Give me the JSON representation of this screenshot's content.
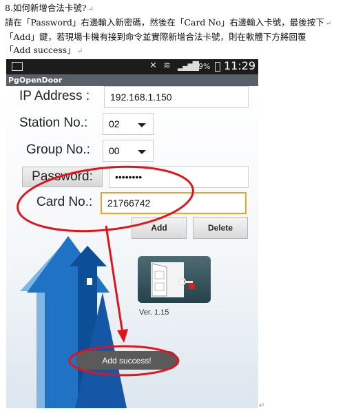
{
  "document": {
    "heading": "8.如何新增合法卡號?",
    "line1": "請在「Password」右邊輸入新密碼，然後在「Card No」右邊輸入卡號，最後按下",
    "line2": "「Add」鍵，若現場卡機有接到命令並實際新增合法卡號，則在軟體下方將回覆",
    "line3": "「Add success」",
    "return_mark": "↵"
  },
  "statusbar": {
    "battery": "69%",
    "time": "11:29",
    "icons": [
      "screenshot-icon",
      "mute-icon",
      "wifi-icon",
      "signal-icon",
      "battery-icon"
    ]
  },
  "app": {
    "title": "PgOpenDoor",
    "ip_label": "IP Address :",
    "ip_value": "192.168.1.150",
    "station_label": "Station No.:",
    "station_value": "02",
    "group_label": "Group No.:",
    "group_value": "00",
    "password_label": "Password:",
    "password_value": "••••••••",
    "card_label": "Card No.:",
    "card_value": "21766742",
    "add_button": "Add",
    "delete_button": "Delete",
    "version": "Ver. 1.15",
    "toast": "Add success!"
  },
  "colors": {
    "annotation": "#e0141a",
    "focus": "#f0a026",
    "arrow_blue": "#1f72c4"
  }
}
